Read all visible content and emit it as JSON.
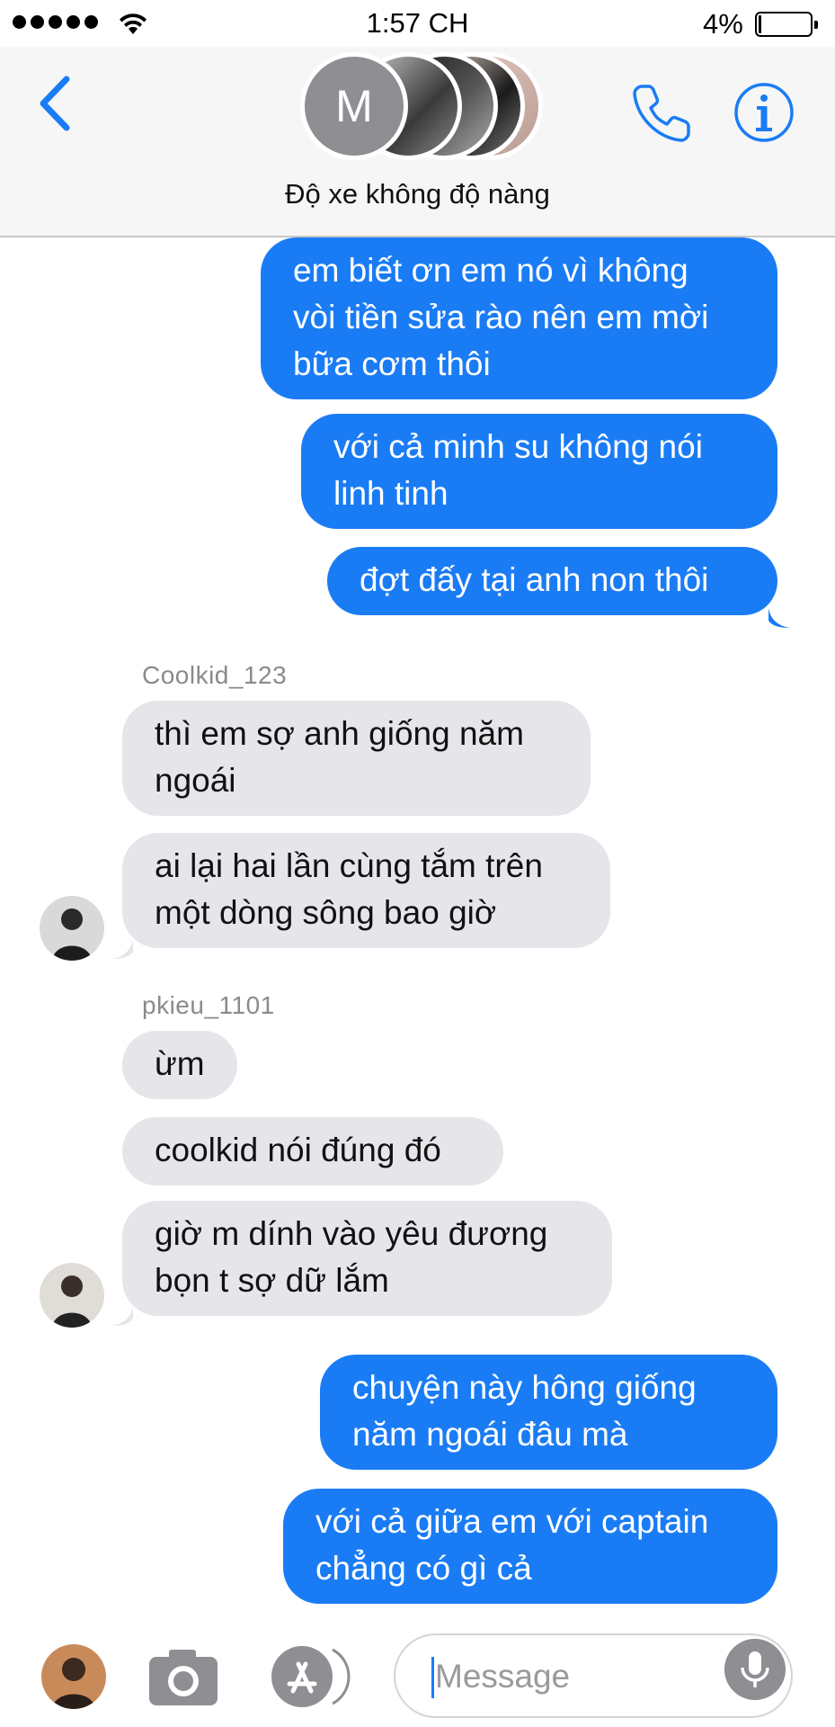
{
  "status_bar": {
    "time": "1:57 CH",
    "battery_percent": "4%",
    "signal_bars": 5
  },
  "header": {
    "group_avatar_letter": "M",
    "group_name": "Độ xe không độ nàng"
  },
  "colors": {
    "accent": "#1a7cf5",
    "incoming_bubble": "#e6e5ea",
    "sender_name": "#8a8a8e"
  },
  "messages": [
    {
      "direction": "outgoing",
      "text": "em biết ơn em nó vì không\nvòi tiền sửa rào nên em mời\nbữa cơm thôi"
    },
    {
      "direction": "outgoing",
      "text": "với cả minh su không nói\nlinh tinh"
    },
    {
      "direction": "outgoing",
      "text": "đợt đấy tại anh non thôi"
    },
    {
      "direction": "sender",
      "text": "Coolkid_123"
    },
    {
      "direction": "incoming",
      "text": "thì em sợ anh giống năm\nngoái"
    },
    {
      "direction": "incoming",
      "text": "ai lại hai lần cùng tắm trên\nmột dòng sông bao giờ"
    },
    {
      "direction": "sender",
      "text": "pkieu_1101"
    },
    {
      "direction": "incoming",
      "text": "ừm"
    },
    {
      "direction": "incoming",
      "text": "coolkid nói đúng đó"
    },
    {
      "direction": "incoming",
      "text": "giờ m dính vào yêu đương\nbọn t sợ dữ lắm"
    },
    {
      "direction": "outgoing",
      "text": "chuyện này hông giống\nnăm ngoái đâu mà"
    },
    {
      "direction": "outgoing",
      "text": "với cả giữa em với captain\nchẳng có gì cả"
    }
  ],
  "input": {
    "placeholder": "Message"
  },
  "icons": {
    "back": "chevron-left-icon",
    "phone": "phone-icon",
    "info": "info-icon",
    "camera": "camera-icon",
    "apps": "app-store-icon",
    "mic": "microphone-icon"
  }
}
